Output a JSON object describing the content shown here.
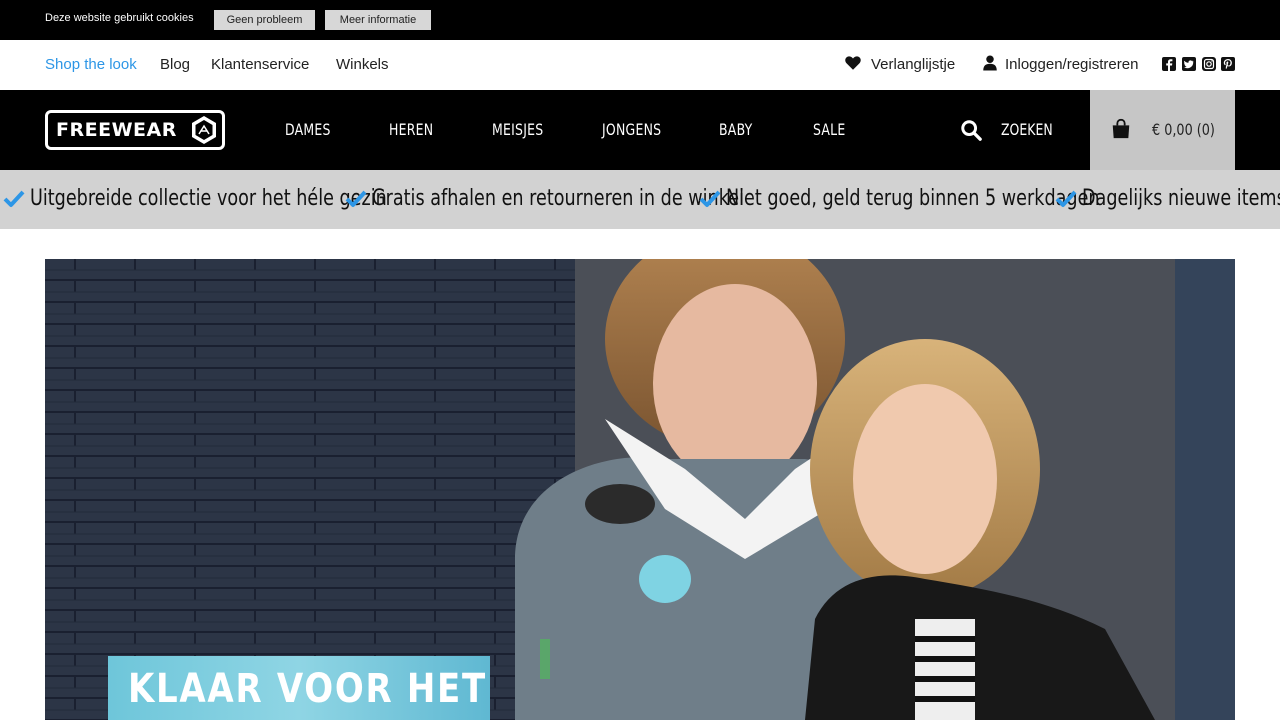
{
  "cookie_bar": {
    "text": "Deze website gebruikt cookies",
    "accept_label": "Geen probleem",
    "info_label": "Meer informatie"
  },
  "top_links": {
    "left": [
      "Shop the look",
      "Blog",
      "Klantenservice",
      "Winkels"
    ],
    "wishlist_label": "Verlanglijstje",
    "login_label": "Inloggen/registreren",
    "social_icons": [
      "facebook-icon",
      "twitter-icon",
      "instagram-icon",
      "pinterest-icon"
    ]
  },
  "main_nav": {
    "logo_text": "FREEWEAR",
    "items": [
      "DAMES",
      "HEREN",
      "MEISJES",
      "JONGENS",
      "BABY",
      "SALE"
    ],
    "search_label": "ZOEKEN",
    "cart_label": "€ 0,00 (0)"
  },
  "usp": [
    "Uitgebreide collectie voor het héle gezin",
    "Gratis afhalen en retourneren in de winkel",
    "Niet goed, geld terug binnen 5 werkdagen",
    "Dagelijks nieuwe items"
  ],
  "hero": {
    "title": "KLAAR VOOR HET"
  },
  "colors": {
    "accent": "#2d96e6",
    "nav_bg": "#000000",
    "usp_bg": "#d2d2d2",
    "cart_bg": "#c6c6c6"
  }
}
